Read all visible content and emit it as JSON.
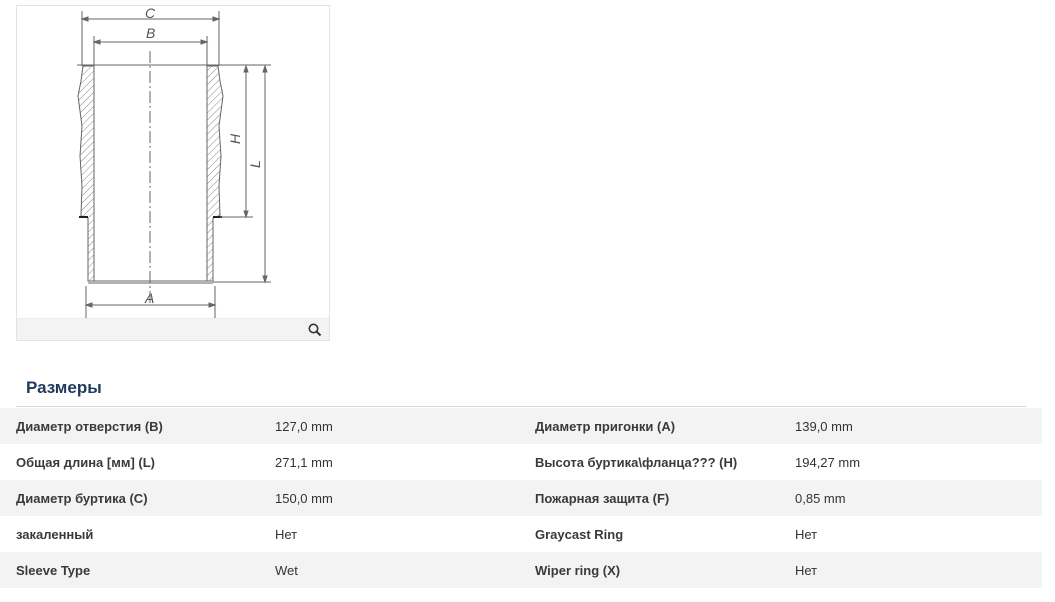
{
  "drawing": {
    "labels": {
      "c": "C",
      "b": "B",
      "a": "A",
      "h": "H",
      "l": "L"
    }
  },
  "icons": {
    "zoom": "magnifier-icon"
  },
  "section": {
    "title": "Размеры"
  },
  "specs": [
    {
      "label1": "Диаметр отверстия (B)",
      "value1": "127,0 mm",
      "label2": "Диаметр пригонки (A)",
      "value2": "139,0 mm"
    },
    {
      "label1": "Общая длина [мм] (L)",
      "value1": "271,1 mm",
      "label2": "Высота буртика\\фланца??? (H)",
      "value2": "194,27 mm"
    },
    {
      "label1": "Диаметр буртика (C)",
      "value1": "150,0 mm",
      "label2": "Пожарная защита (F)",
      "value2": "0,85 mm"
    },
    {
      "label1": "закаленный",
      "value1": "Нет",
      "label2": "Graycast Ring",
      "value2": "Нет"
    },
    {
      "label1": "Sleeve Type",
      "value1": "Wet",
      "label2": "Wiper ring (X)",
      "value2": "Нет"
    }
  ]
}
